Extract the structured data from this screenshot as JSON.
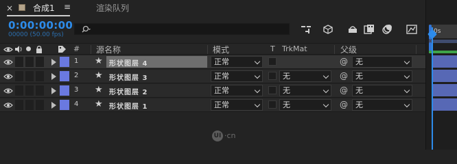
{
  "tabs": {
    "close": "×",
    "active_label": "合成1",
    "menu": "≡",
    "render_label": "渲染队列"
  },
  "composition": {
    "timecode": "0:00:00:00",
    "frames": "00000 (50.00 fps)"
  },
  "search": {
    "prefix": "⌕",
    "value": ""
  },
  "columns": {
    "num": "#",
    "source_name": "源名称",
    "mode": "模式",
    "t": "T",
    "trkmat": "TrkMat",
    "parent": "父级"
  },
  "layers": [
    {
      "num": "1",
      "name": "形状图层 4",
      "mode": "正常",
      "trkmat": "",
      "parent": "无",
      "selected": true
    },
    {
      "num": "2",
      "name": "形状图层 3",
      "mode": "正常",
      "trkmat": "无",
      "parent": "无",
      "selected": false
    },
    {
      "num": "3",
      "name": "形状图层 2",
      "mode": "正常",
      "trkmat": "无",
      "parent": "无",
      "selected": false
    },
    {
      "num": "4",
      "name": "形状图层 1",
      "mode": "正常",
      "trkmat": "无",
      "parent": "无",
      "selected": false
    }
  ],
  "timeline": {
    "ruler_label": "0s"
  },
  "watermark": {
    "logo": "UI",
    "text": "·cn"
  },
  "colors": {
    "accent": "#2d8ceb",
    "label": "#6a79e0",
    "layer_bar": "#5768b5",
    "work_area": "#3ea34a"
  }
}
